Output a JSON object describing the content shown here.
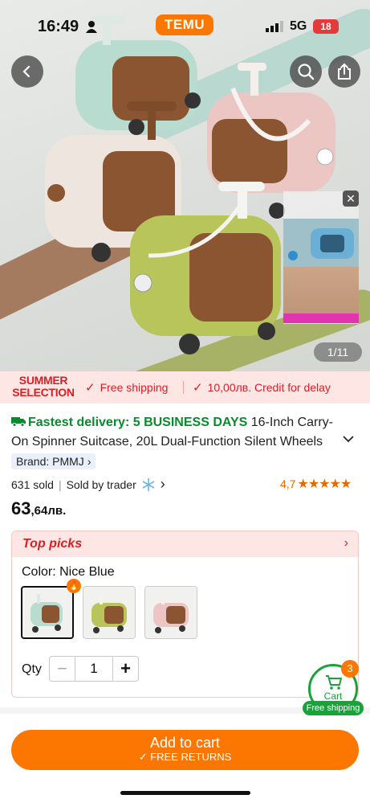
{
  "status_bar": {
    "time": "16:49",
    "network": "5G",
    "battery": "18"
  },
  "brand_logo": "TEMU",
  "gallery": {
    "pager": "1/11",
    "close_glyph": "✕"
  },
  "promo": {
    "badge_line1": "SUMMER",
    "badge_line2": "SELECTION",
    "free_shipping": "Free shipping",
    "credit": "10,00лв. Credit for delay"
  },
  "product": {
    "delivery": "Fastest delivery: 5 BUSINESS DAYS",
    "title": "16-Inch Carry-On Spinner Suitcase, 20L Dual-Function Silent Wheels",
    "brand": "Brand: PMMJ",
    "sold": "631 sold",
    "seller": "Sold by trader",
    "rating": "4,7",
    "stars": "★★★★★",
    "price_int": "63",
    "price_dec": ",64лв."
  },
  "top_picks": {
    "title": "Top picks",
    "color_label": "Color: Nice Blue",
    "qty_label": "Qty",
    "qty_value": "1",
    "minus": "−",
    "plus": "+"
  },
  "cart": {
    "count": "3",
    "label": "Cart",
    "free_shipping": "Free shipping"
  },
  "cta": {
    "main": "Add to cart",
    "sub": "✓ FREE RETURNS"
  },
  "colors": {
    "accent_orange": "#fb7701",
    "promo_red": "#d81f26",
    "delivery_green": "#0a8a2e",
    "star_orange": "#e46a00"
  }
}
